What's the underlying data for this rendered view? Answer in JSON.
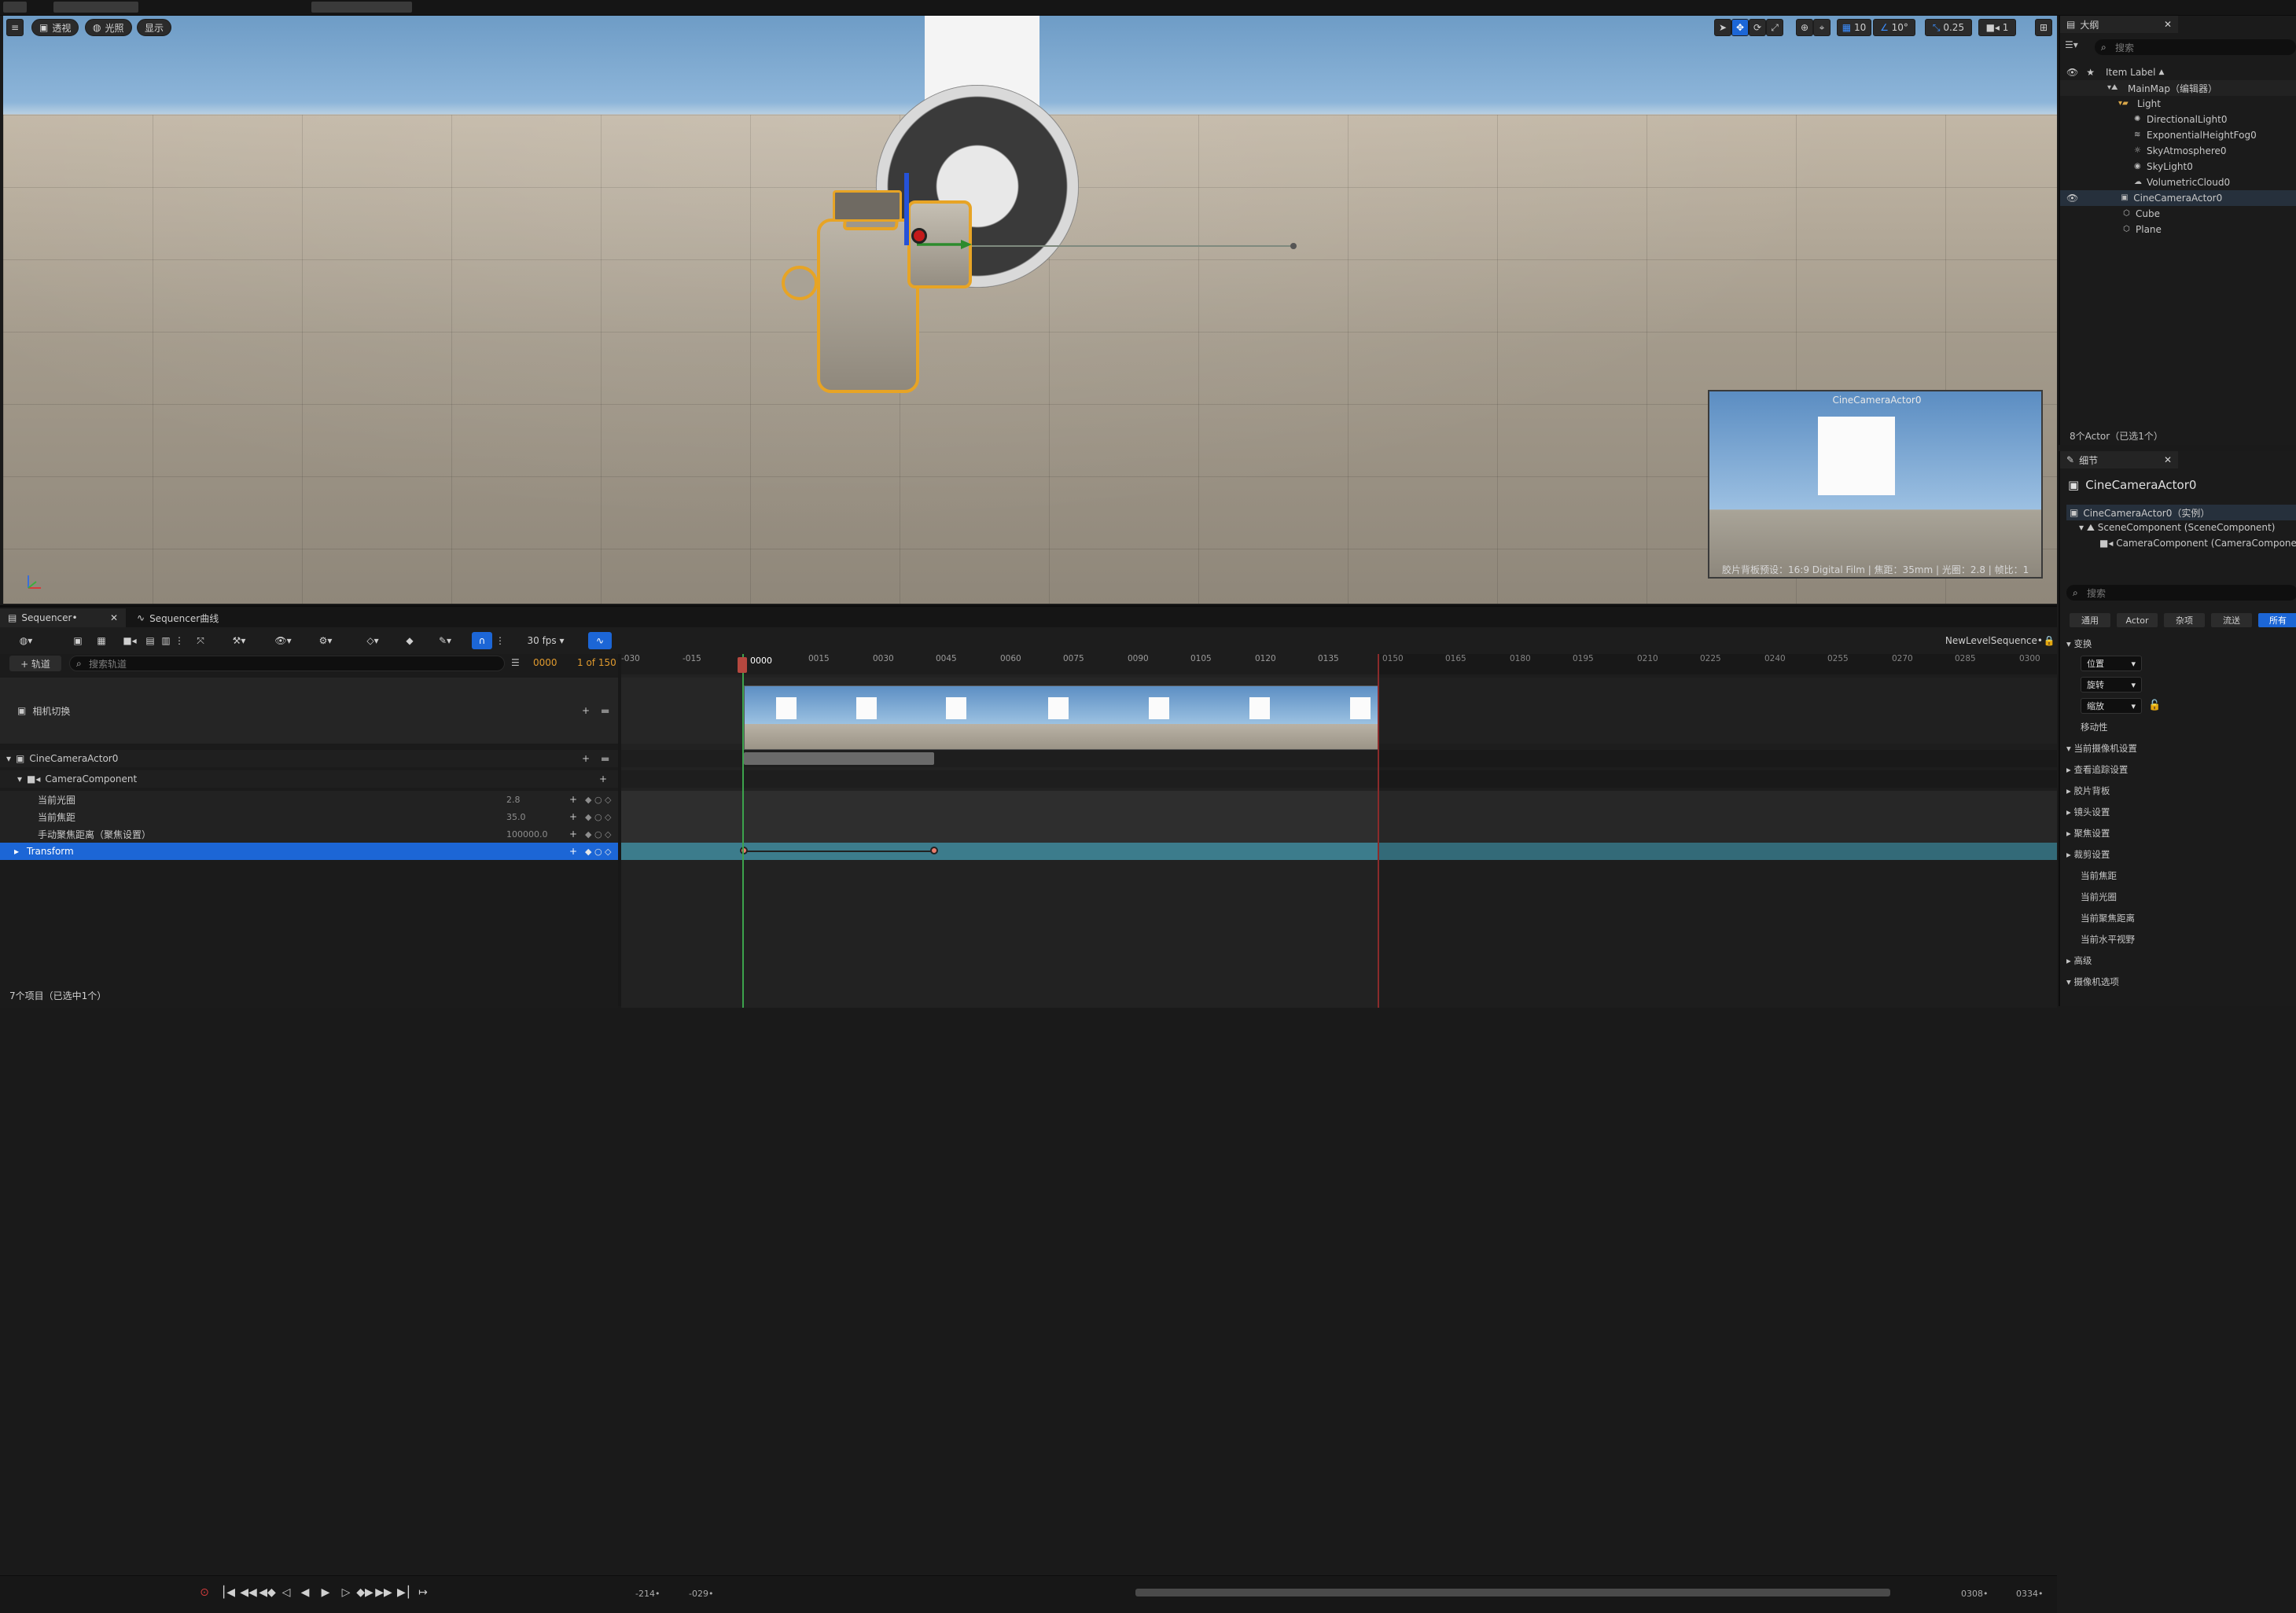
{
  "viewport": {
    "menu_btn": "≡",
    "perspective_label": "透视",
    "lit_label": "光照",
    "show_label": "显示",
    "grid_value": "10",
    "angle_value": "10°",
    "scale_value": "0.25",
    "camera_speed_value": "1",
    "pip": {
      "title": "CineCameraActor0",
      "caption": "胶片背板预设：16:9 Digital Film | 焦距：35mm | 光圈：2.8 | 帧比：1"
    }
  },
  "outliner": {
    "tab_label": "大纲",
    "search_placeholder": "搜索",
    "column_label": "Item Label",
    "items": [
      {
        "label": "MainMap（编辑器）"
      },
      {
        "label": "Light"
      },
      {
        "label": "DirectionalLight0"
      },
      {
        "label": "ExponentialHeightFog0"
      },
      {
        "label": "SkyAtmosphere0"
      },
      {
        "label": "SkyLight0"
      },
      {
        "label": "VolumetricCloud0"
      },
      {
        "label": "CineCameraActor0"
      },
      {
        "label": "Cube"
      },
      {
        "label": "Plane"
      }
    ],
    "status": "8个Actor（已选1个）"
  },
  "details": {
    "tab_label": "细节",
    "actor_name": "CineCameraActor0",
    "instance_label": "CineCameraActor0（实例）",
    "component1": "SceneComponent (SceneComponent)",
    "component2": "CameraComponent (CameraComponent)",
    "search_placeholder": "搜索",
    "filters": [
      "通用",
      "Actor",
      "杂项",
      "流送",
      "所有"
    ],
    "transform_header": "变换",
    "location_label": "位置",
    "rotation_label": "旋转",
    "scale_label": "缩放",
    "mobility_label": "移动性",
    "sections": [
      "当前摄像机设置",
      "查看追踪设置",
      "胶片背板",
      "镜头设置",
      "聚焦设置",
      "裁剪设置",
      "当前焦距",
      "当前光圈",
      "当前聚焦距离",
      "当前水平视野",
      "高级",
      "摄像机选项"
    ]
  },
  "sequencer": {
    "tab_label": "Sequencer•",
    "curves_tab_label": "Sequencer曲线",
    "fps_label": "30 fps",
    "sequence_name": "NewLevelSequence•",
    "add_track_label": "+ 轨道",
    "search_placeholder": "搜索轨道",
    "current_frame": "0000",
    "frame_of_total": "1 of 150",
    "tracks": {
      "camera_cut": "相机切换",
      "actor": "CineCameraActor0",
      "component": "CameraComponent",
      "aperture_label": "当前光圈",
      "aperture_value": "2.8",
      "focal_label": "当前焦距",
      "focal_value": "35.0",
      "focus_label": "手动聚焦距离（聚焦设置）",
      "focus_value": "100000.0",
      "transform": "Transform"
    },
    "ruler": {
      "playhead_label": "0000",
      "ticks": [
        "-030",
        "-015",
        "0015",
        "0030",
        "0045",
        "0060",
        "0075",
        "0090",
        "0105",
        "0120",
        "0135",
        "0150",
        "0165",
        "0180",
        "0195",
        "0210",
        "0225",
        "0240",
        "0255",
        "0270",
        "0285",
        "0300"
      ]
    },
    "status": "7个项目（已选中1个）",
    "range_start": "-214•",
    "range_view_start": "-029•",
    "range_view_end": "0308•",
    "range_end": "0334•",
    "keyframe_controls": "◆ ○ ◇"
  }
}
